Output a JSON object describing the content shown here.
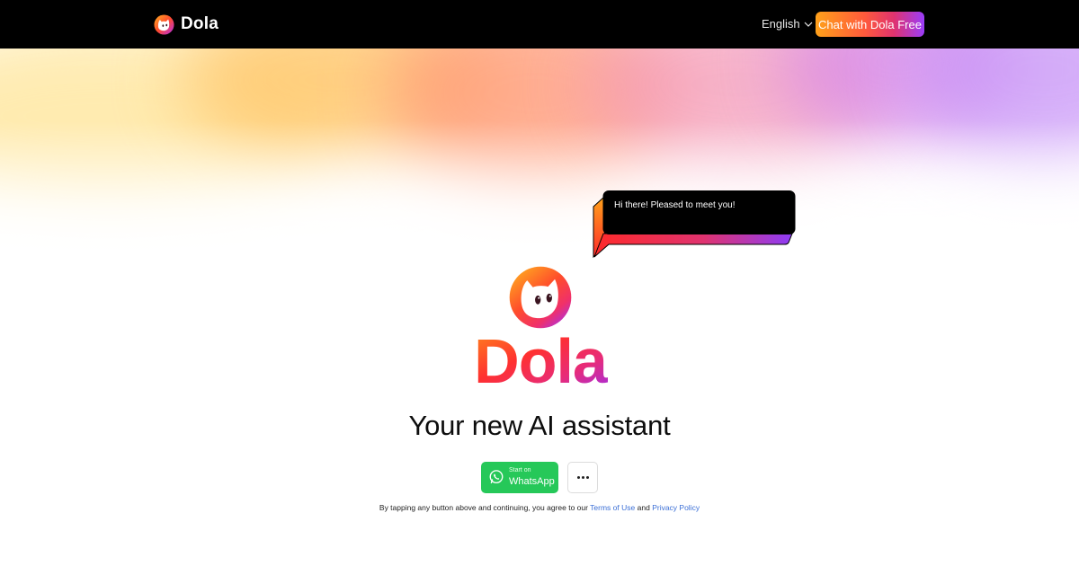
{
  "header": {
    "brand_name": "Dola",
    "language": "English",
    "cta_label": "Chat with Dola Free"
  },
  "bubble": {
    "text": "Hi there! Pleased to meet you!"
  },
  "hero": {
    "wordmark": "Dola",
    "tagline": "Your new AI assistant"
  },
  "actions": {
    "whatsapp_small": "Start on",
    "whatsapp_label": "WhatsApp",
    "more_icon": "more-horizontal-icon"
  },
  "legal": {
    "prefix": "By tapping any button above and continuing, you agree to our",
    "terms": "Terms of Use",
    "joiner": "and",
    "privacy": "Privacy Policy"
  },
  "colors": {
    "header_bg": "#000000",
    "whatsapp_green": "#26c859",
    "link_blue": "#3b6fd6",
    "gradient_orange": "#ffa11a",
    "gradient_red": "#ff3b3b",
    "gradient_magenta": "#e0336f",
    "gradient_purple": "#9a3dfa"
  }
}
